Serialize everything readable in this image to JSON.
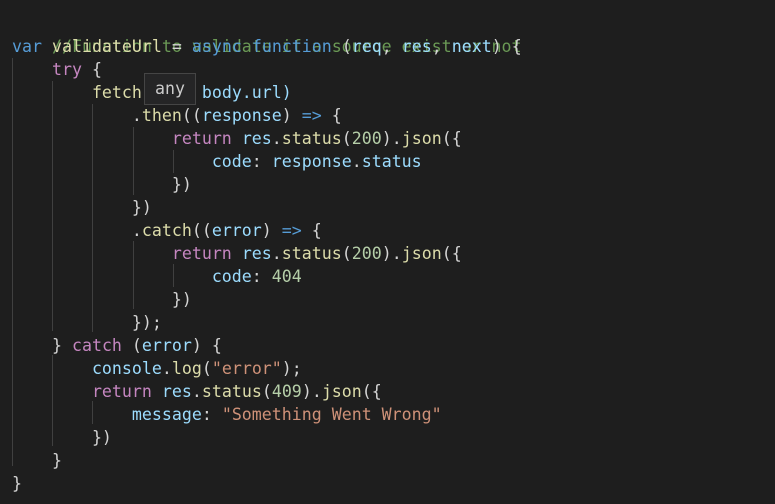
{
  "code": {
    "comment": "//Function to validate if a source exist or not",
    "kw_var": "var",
    "fn_name": "validateUrl",
    "equals": "=",
    "kw_async": "async",
    "kw_function": "function",
    "p_open": "(",
    "param_req": "req",
    "comma": ",",
    "param_res": "res",
    "param_next": "next",
    "p_close_brace": ") {",
    "kw_try": "try",
    "brace_open": "{",
    "fetch": "fetch",
    "body_url": "body.url)",
    "dot": ".",
    "then": "then",
    "dbl_paren": "((",
    "response": "response",
    "arrow_close": ")",
    "arrow": "=>",
    "kw_return": "return",
    "res": "res",
    "status": "status",
    "num_200": "200",
    "json": "json",
    "json_open": "({",
    "paren_close": ")",
    "code_key": "code",
    "colon": ":",
    "response_status_obj": "response",
    "status_prop": "status",
    "close_obj": "})",
    "catch_method": "catch",
    "error": "error",
    "num_404": "404",
    "close_semicolon": "});",
    "brace_close": "}",
    "kw_catch": "catch",
    "paren_error_open": "(",
    "paren_error_close": ") {",
    "console": "console",
    "log": "log",
    "log_open": "(",
    "str_error": "\"error\"",
    "log_close": ");",
    "num_409": "409",
    "message_key": "message",
    "str_message": "\"Something Went Wrong\""
  },
  "tooltip": {
    "text": "any"
  },
  "colors": {
    "background": "#1e1e1e",
    "comment": "#6a9955",
    "keyword": "#569cd6",
    "control_keyword": "#c586c0",
    "function": "#dcdcaa",
    "variable": "#9cdcfe",
    "number": "#b5cea8",
    "string": "#ce9178"
  }
}
